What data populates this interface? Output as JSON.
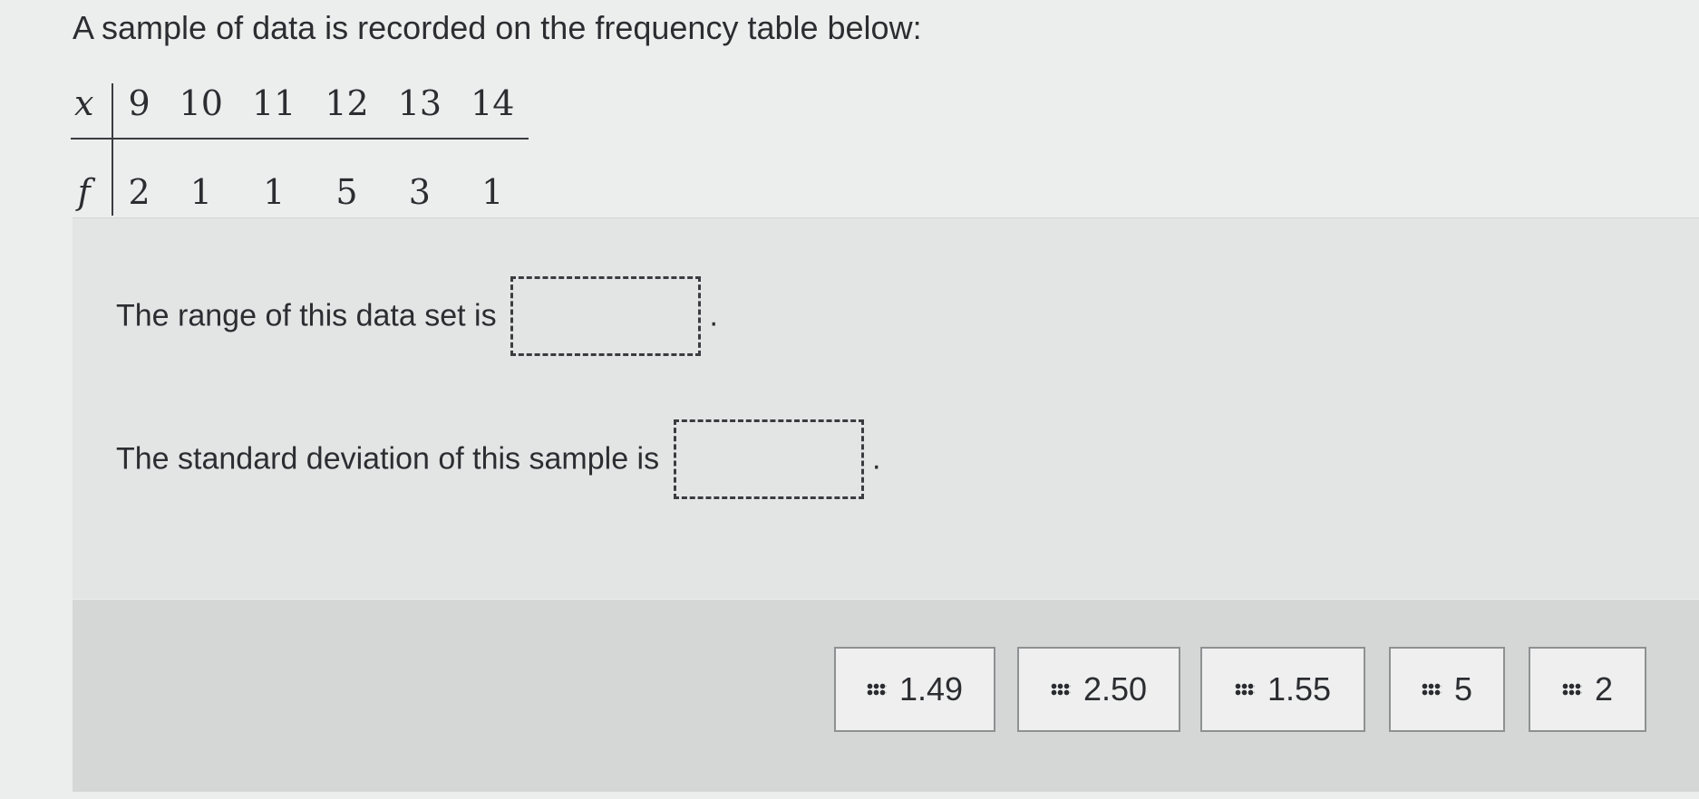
{
  "prompt": "A sample of data is recorded on the frequency table below:",
  "table": {
    "x_header": "x",
    "f_header": "f",
    "x_values": [
      "9",
      "10",
      "11",
      "12",
      "13",
      "14"
    ],
    "f_values": [
      "2",
      "1",
      "1",
      "5",
      "3",
      "1"
    ]
  },
  "questions": {
    "range_label": "The range of this data set is",
    "std_label": "The standard deviation of this sample is",
    "terminator": "."
  },
  "answer_tiles": [
    "1.49",
    "2.50",
    "1.55",
    "5",
    "2"
  ],
  "icons": {
    "tile_grip": "drag-handle-icon"
  }
}
